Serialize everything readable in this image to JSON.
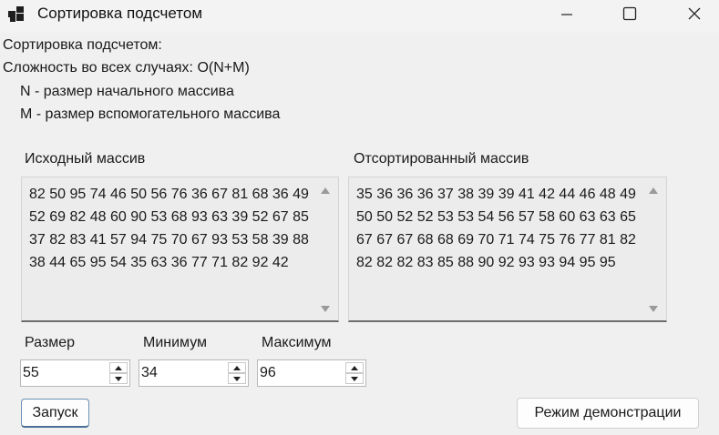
{
  "window": {
    "title": "Сортировка подсчетом",
    "icon": "app-windows-icon",
    "controls": {
      "minimize": "minimize-icon",
      "maximize": "maximize-icon",
      "close": "close-icon"
    }
  },
  "info": {
    "line1": "Сортировка подсчетом:",
    "line2": "Сложность во всех случаях: O(N+M)",
    "line3": "N - размер начального массива",
    "line4": "M - размер вспомогательного массива"
  },
  "source_array": {
    "label": "Исходный массив",
    "text": "82 50 95 74 46 50 56 76 36 67 81 68 36 49 52 69 82 48 60 90 53 68 93 63 39 52 67 85 37 82 83 41 57 94 75 70 67 93 53 58 39 88 38 44 65 95 54 35 63 36 77 71 82 92 42"
  },
  "sorted_array": {
    "label": "Отсортированный массив",
    "text": "35 36 36 36 37 38 39 39 41 42 44 46 48 49 50 50 52 52 53 53 54 56 57 58 60 63 63 65 67 67 67 68 68 69 70 71 74 75 76 77 81 82 82 82 82 83 85 88 90 92 93 93 94 95 95"
  },
  "params": {
    "size_label": "Размер",
    "size_value": "55",
    "min_label": "Минимум",
    "min_value": "34",
    "max_label": "Максимум",
    "max_value": "96"
  },
  "buttons": {
    "run": "Запуск",
    "demo": "Режим демонстрации"
  }
}
